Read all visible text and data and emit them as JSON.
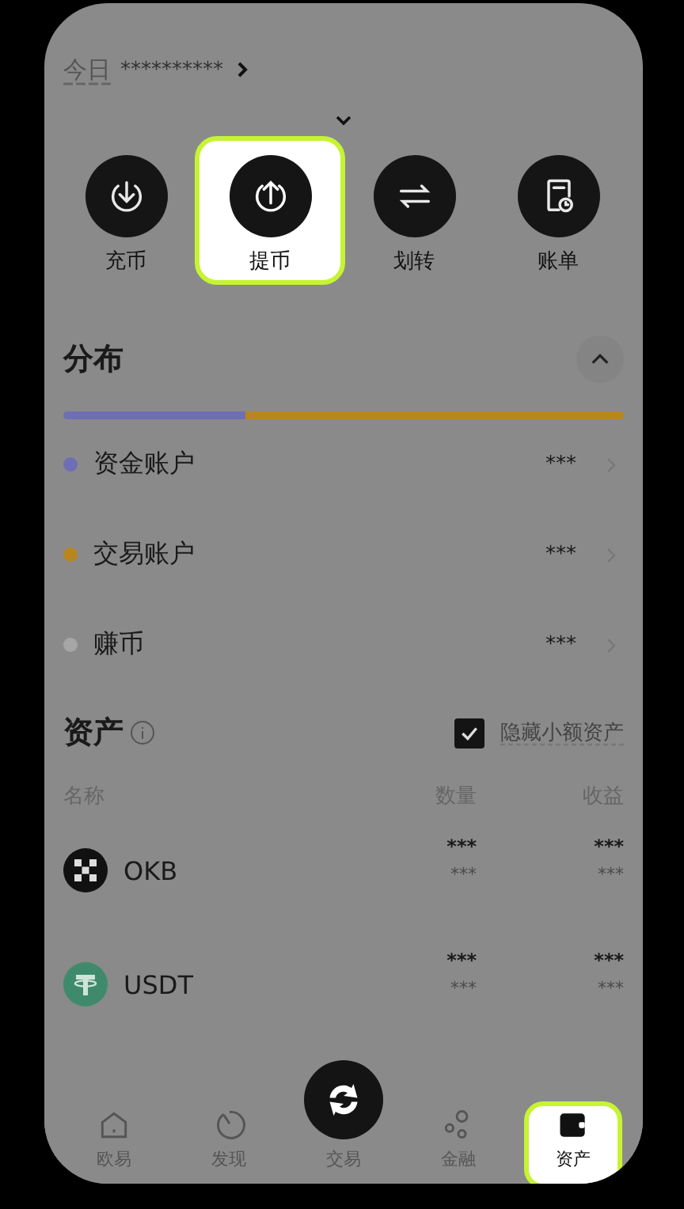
{
  "header": {
    "label": "今日",
    "value": "**********"
  },
  "actions": [
    {
      "label": "充币",
      "kind": "deposit",
      "highlighted": false
    },
    {
      "label": "提币",
      "kind": "withdraw",
      "highlighted": true
    },
    {
      "label": "划转",
      "kind": "transfer",
      "highlighted": false
    },
    {
      "label": "账单",
      "kind": "bill",
      "highlighted": false
    }
  ],
  "distribution": {
    "title": "分布",
    "expanded": true,
    "bar": {
      "level": 0.325
    },
    "accounts": [
      {
        "name": "资金账户",
        "color": "#6e6eb4",
        "value": "***"
      },
      {
        "name": "交易账户",
        "color": "#b8861f",
        "value": "***"
      },
      {
        "name": "赚币",
        "color": "#a6a6a6",
        "value": "***"
      }
    ]
  },
  "assets": {
    "title": "资产",
    "hide_small": {
      "label": "隐藏小额资产",
      "checked": true
    },
    "columns": [
      "名称",
      "数量",
      "收益"
    ],
    "rows": [
      {
        "symbol": "OKB",
        "kind": "okb",
        "amount": "***",
        "amount_sub": "***",
        "pnl": "***",
        "pnl_sub": "***"
      },
      {
        "symbol": "USDT",
        "kind": "usdt",
        "amount": "***",
        "amount_sub": "***",
        "pnl": "***",
        "pnl_sub": "***"
      }
    ]
  },
  "nav": [
    {
      "label": "欧易",
      "kind": "home",
      "selected": false,
      "highlighted": false
    },
    {
      "label": "发现",
      "kind": "discover",
      "selected": false,
      "highlighted": false
    },
    {
      "label": "交易",
      "kind": "trade",
      "selected": false,
      "highlighted": false
    },
    {
      "label": "金融",
      "kind": "finance",
      "selected": false,
      "highlighted": false
    },
    {
      "label": "资产",
      "kind": "wallet",
      "selected": true,
      "highlighted": true
    }
  ]
}
